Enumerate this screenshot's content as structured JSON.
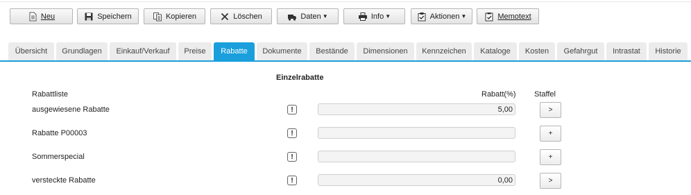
{
  "toolbar": {
    "new": "Neu",
    "save": "Speichern",
    "copy": "Kopieren",
    "delete": "Löschen",
    "data": "Daten",
    "info": "Info",
    "actions": "Aktionen",
    "memo": "Memotext"
  },
  "tabs": [
    "Übersicht",
    "Grundlagen",
    "Einkauf/Verkauf",
    "Preise",
    "Rabatte",
    "Dokumente",
    "Bestände",
    "Dimensionen",
    "Kennzeichen",
    "Kataloge",
    "Kosten",
    "Gefahrgut",
    "Intrastat",
    "Historie"
  ],
  "active_tab": "Rabatte",
  "section_title": "Einzelrabatte",
  "headers": {
    "list": "Rabattliste",
    "rabatt": "Rabatt(%)",
    "staffel": "Staffel"
  },
  "rows": [
    {
      "label": "ausgewiesene Rabatte",
      "warn": "!",
      "value": "5,00",
      "button": ">"
    },
    {
      "label": "Rabatte P00003",
      "warn": "!",
      "value": "",
      "button": "+"
    },
    {
      "label": "Sommerspecial",
      "warn": "!",
      "value": "",
      "button": "+"
    },
    {
      "label": "versteckte Rabatte",
      "warn": "!",
      "value": "0,00",
      "button": ">"
    }
  ],
  "colors": {
    "accent": "#1a9fdc",
    "tab_bg": "#ececec"
  },
  "icons": [
    "document-icon",
    "save-icon",
    "copy-icon",
    "close-icon",
    "truck-icon",
    "printer-icon",
    "clipboard-icon",
    "memo-icon"
  ]
}
